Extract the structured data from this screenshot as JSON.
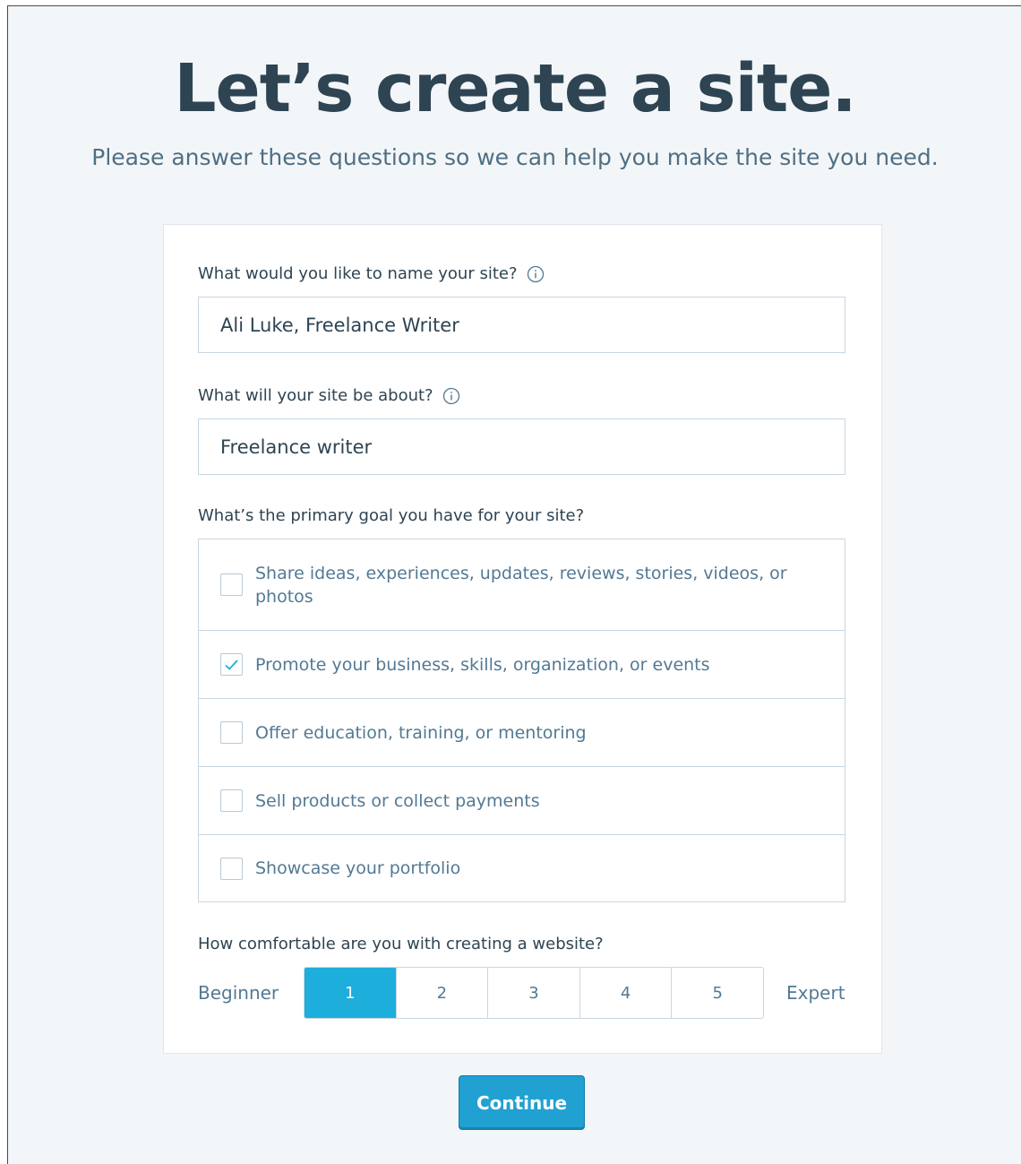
{
  "header": {
    "title": "Let’s create a site.",
    "subtitle": "Please answer these questions so we can help you make the site you need."
  },
  "form": {
    "name_label": "What would you like to name your site?",
    "name_value": "Ali Luke, Freelance Writer",
    "about_label": "What will your site be about?",
    "about_value": "Freelance writer",
    "goal_label": "What’s the primary goal you have for your site?",
    "goals": [
      {
        "label": "Share ideas, experiences, updates, reviews, stories, videos, or photos",
        "checked": false
      },
      {
        "label": "Promote your business, skills, organization, or events",
        "checked": true
      },
      {
        "label": "Offer education, training, or mentoring",
        "checked": false
      },
      {
        "label": "Sell products or collect payments",
        "checked": false
      },
      {
        "label": "Showcase your portfolio",
        "checked": false
      }
    ],
    "comfort_label": "How comfortable are you with creating a website?",
    "comfort_min_label": "Beginner",
    "comfort_max_label": "Expert",
    "comfort_options": [
      "1",
      "2",
      "3",
      "4",
      "5"
    ],
    "comfort_selected": "1"
  },
  "actions": {
    "continue_label": "Continue"
  },
  "icons": {
    "info": "info-icon",
    "check": "checkmark-icon"
  },
  "colors": {
    "accent": "#1eaedb",
    "button": "#20a1d2",
    "text": "#2e4453",
    "muted": "#537994",
    "background": "#f3f6f8"
  }
}
